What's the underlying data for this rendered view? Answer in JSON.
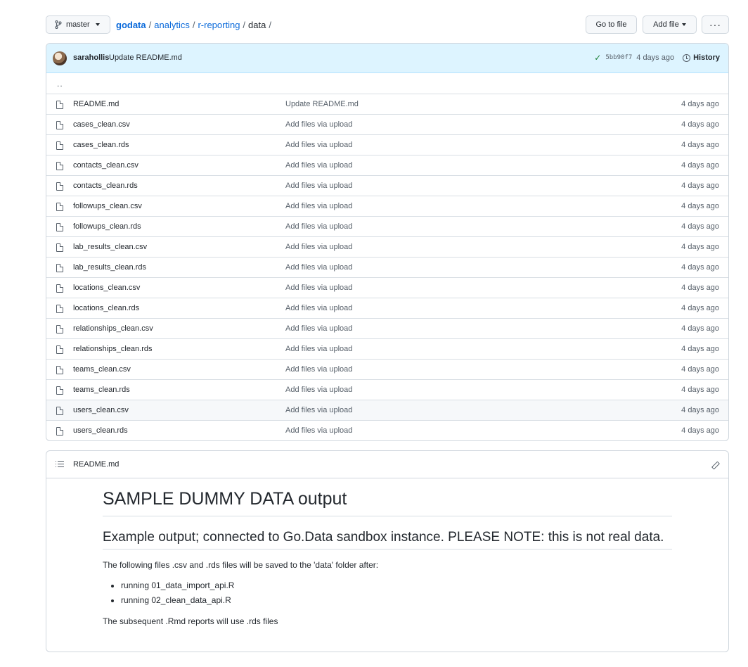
{
  "topbar": {
    "branch": "master",
    "crumbs": {
      "root": "godata",
      "p1": "analytics",
      "p2": "r-reporting",
      "current": "data",
      "sep": "/"
    },
    "goto_label": "Go to file",
    "add_label": "Add file",
    "more_label": "···"
  },
  "commit": {
    "author": "sarahollis",
    "message": "Update README.md",
    "sha": "5bb90f7",
    "age": "4 days ago",
    "history_label": "History"
  },
  "parent_link": "..",
  "files": [
    {
      "name": "README.md",
      "message": "Update README.md",
      "age": "4 days ago"
    },
    {
      "name": "cases_clean.csv",
      "message": "Add files via upload",
      "age": "4 days ago"
    },
    {
      "name": "cases_clean.rds",
      "message": "Add files via upload",
      "age": "4 days ago"
    },
    {
      "name": "contacts_clean.csv",
      "message": "Add files via upload",
      "age": "4 days ago"
    },
    {
      "name": "contacts_clean.rds",
      "message": "Add files via upload",
      "age": "4 days ago"
    },
    {
      "name": "followups_clean.csv",
      "message": "Add files via upload",
      "age": "4 days ago"
    },
    {
      "name": "followups_clean.rds",
      "message": "Add files via upload",
      "age": "4 days ago"
    },
    {
      "name": "lab_results_clean.csv",
      "message": "Add files via upload",
      "age": "4 days ago"
    },
    {
      "name": "lab_results_clean.rds",
      "message": "Add files via upload",
      "age": "4 days ago"
    },
    {
      "name": "locations_clean.csv",
      "message": "Add files via upload",
      "age": "4 days ago"
    },
    {
      "name": "locations_clean.rds",
      "message": "Add files via upload",
      "age": "4 days ago"
    },
    {
      "name": "relationships_clean.csv",
      "message": "Add files via upload",
      "age": "4 days ago"
    },
    {
      "name": "relationships_clean.rds",
      "message": "Add files via upload",
      "age": "4 days ago"
    },
    {
      "name": "teams_clean.csv",
      "message": "Add files via upload",
      "age": "4 days ago"
    },
    {
      "name": "teams_clean.rds",
      "message": "Add files via upload",
      "age": "4 days ago"
    },
    {
      "name": "users_clean.csv",
      "message": "Add files via upload",
      "age": "4 days ago"
    },
    {
      "name": "users_clean.rds",
      "message": "Add files via upload",
      "age": "4 days ago"
    }
  ],
  "readme": {
    "file_label": "README.md",
    "h1": "SAMPLE DUMMY DATA output",
    "h2": "Example output; connected to Go.Data sandbox instance. PLEASE NOTE: this is not real data.",
    "intro": "The following files .csv and .rds files will be saved to the 'data' folder after:",
    "items": [
      "running 01_data_import_api.R",
      "running 02_clean_data_api.R"
    ],
    "outro": "The subsequent .Rmd reports will use .rds files"
  }
}
